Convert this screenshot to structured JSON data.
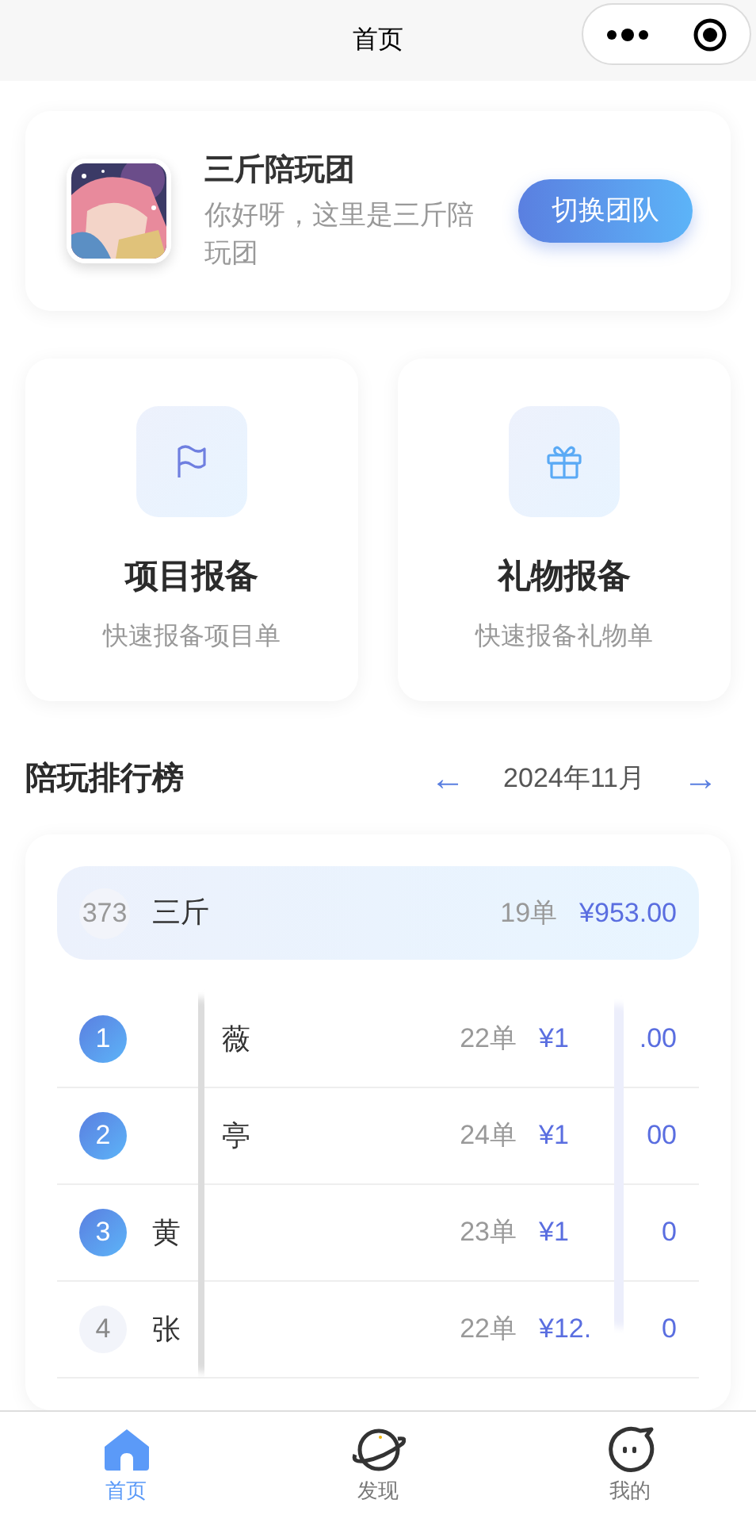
{
  "nav_bar": {
    "title": "首页"
  },
  "team_card": {
    "name": "三斤陪玩团",
    "greeting": "你好呀，这里是三斤陪玩团",
    "switch_button": "切换团队"
  },
  "actions": [
    {
      "kind": "flag",
      "title": "项目报备",
      "subtitle": "快速报备项目单"
    },
    {
      "kind": "gift",
      "title": "礼物报备",
      "subtitle": "快速报备礼物单"
    }
  ],
  "ranking": {
    "title": "陪玩排行榜",
    "prev": "←",
    "month": "2024年11月",
    "next": "→",
    "me": {
      "rank": "373",
      "name": "三斤",
      "orders": "19单",
      "amount": "¥953.00"
    },
    "rows": [
      {
        "rank": "1",
        "top": true,
        "name_start": "",
        "name_end": "薇",
        "orders": "22单",
        "amount_start": "¥1",
        "amount_end": ".00"
      },
      {
        "rank": "2",
        "top": true,
        "name_start": "",
        "name_end": "亭",
        "orders": "24单",
        "amount_start": "¥1",
        "amount_end": "00"
      },
      {
        "rank": "3",
        "top": true,
        "name_start": "黄",
        "name_end": "",
        "orders": "23单",
        "amount_start": "¥1",
        "amount_end": "0"
      },
      {
        "rank": "4",
        "top": false,
        "name_start": "张",
        "name_end": "",
        "orders": "22单",
        "amount_start": "¥12.",
        "amount_end": "0"
      }
    ]
  },
  "tab_bar": [
    {
      "kind": "home",
      "label": "首页",
      "selected": true
    },
    {
      "kind": "planet",
      "label": "发现",
      "selected": false
    },
    {
      "kind": "face",
      "label": "我的",
      "selected": false
    }
  ]
}
